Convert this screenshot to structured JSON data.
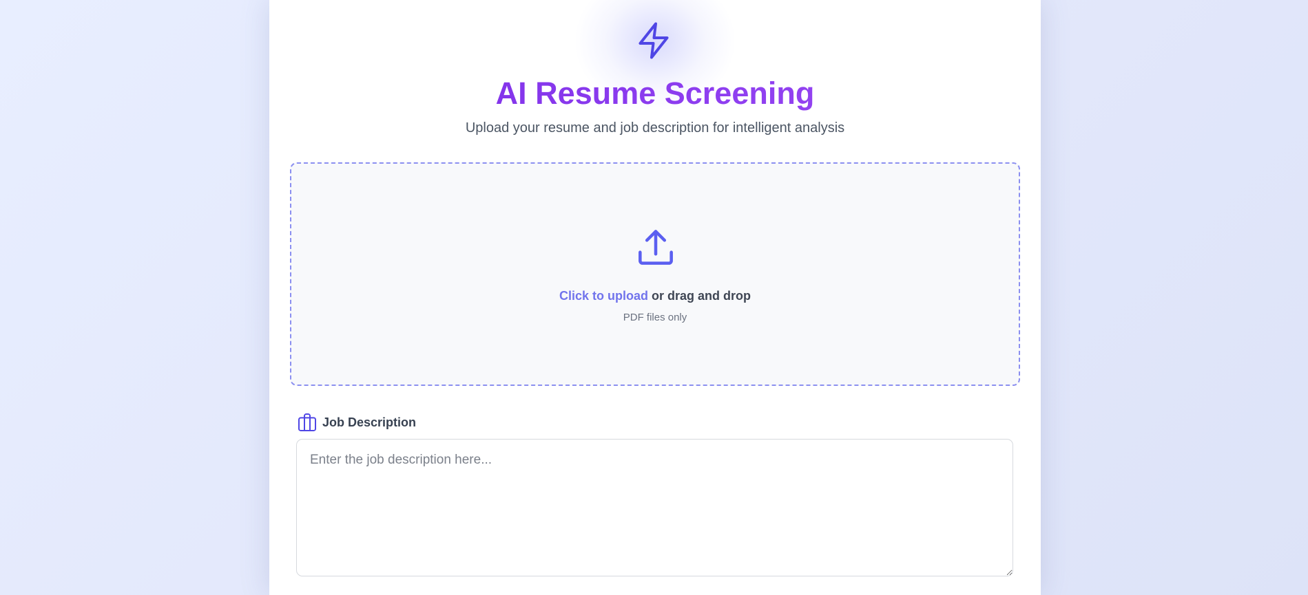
{
  "header": {
    "icon": "lightning-bolt-icon",
    "title": "AI Resume Screening",
    "subtitle": "Upload your resume and job description for intelligent analysis"
  },
  "upload": {
    "icon": "upload-icon",
    "link_text": "Click to upload",
    "rest_text": " or drag and drop",
    "hint": "PDF files only"
  },
  "job_description": {
    "icon": "briefcase-icon",
    "label": "Job Description",
    "placeholder": "Enter the job description here...",
    "value": ""
  },
  "colors": {
    "accent": "#4f46e5",
    "title_gradient_start": "#7a2be6",
    "title_gradient_end": "#9b48f2",
    "dropzone_border": "#8b8ff0",
    "link": "#7174ec"
  }
}
